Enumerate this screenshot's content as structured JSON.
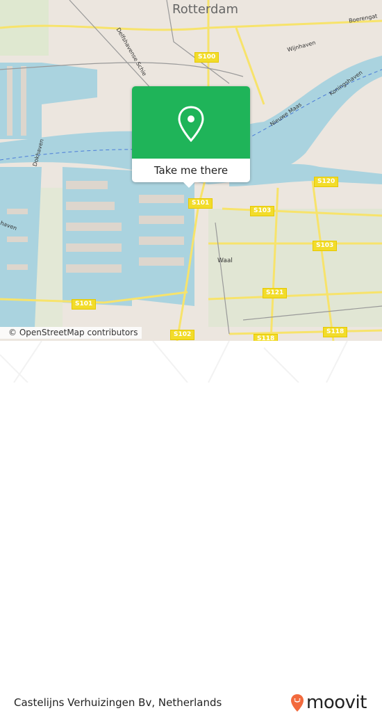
{
  "map": {
    "city_label": "Rotterdam",
    "road_shields": [
      "S100",
      "S101",
      "S101",
      "S102",
      "S103",
      "S103",
      "S118",
      "S118",
      "S120",
      "S121"
    ],
    "street_labels": {
      "wijnhaven": "Wijnhaven",
      "boerengat": "Boerengat",
      "koningshaven": "Koningshaven",
      "nieuwe_maas": "Nieuwe Maas",
      "dokhaven": "Dokhaven",
      "delfshavense_schie": "Delfshavense Schie",
      "waal": "Waal",
      "haven": "haven"
    },
    "attribution": "© OpenStreetMap contributors",
    "colors": {
      "land": "#ece6df",
      "water": "#aad3df",
      "park": "#cde8b8",
      "road": "#f7e36b",
      "accent": "#1fb459"
    }
  },
  "popup": {
    "pin_icon": "map-pin-icon",
    "button_label": "Take me there"
  },
  "footer": {
    "place_name": "Castelijns Verhuizingen Bv, Netherlands",
    "logo_text": "moovit",
    "logo_color": "#f26a3d"
  }
}
